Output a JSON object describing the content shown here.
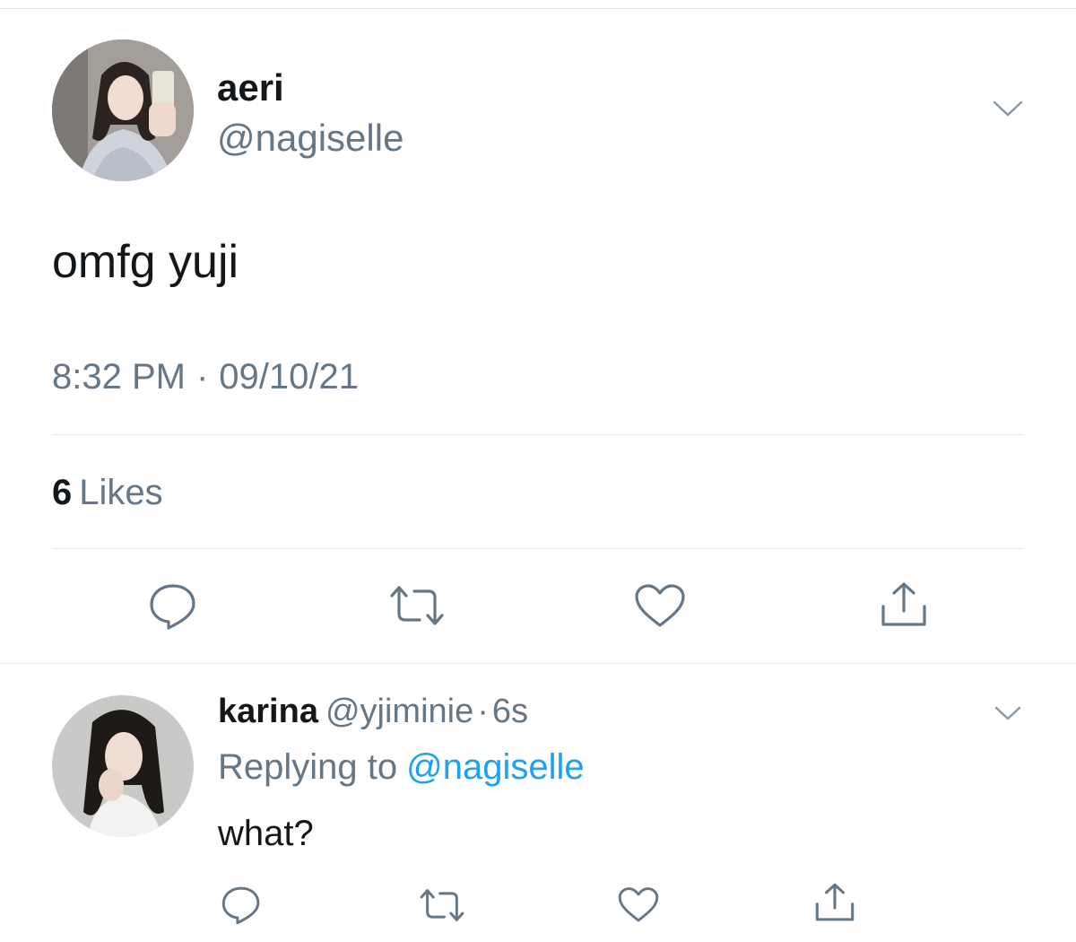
{
  "colors": {
    "text": "#14171a",
    "muted": "#657786",
    "link": "#1da1f2",
    "divider": "#e1e4e8",
    "icon": "#657786"
  },
  "main_tweet": {
    "display_name": "aeri",
    "handle": "@nagiselle",
    "text": "omfg yuji",
    "time": "8:32 PM",
    "date": "09/10/21",
    "separator": "·",
    "likes_count": "6",
    "likes_label": "Likes",
    "actions": [
      "comment-icon",
      "retweet-icon",
      "heart-icon",
      "share-icon"
    ],
    "menu_icon": "chevron-down-icon"
  },
  "reply_tweet": {
    "display_name": "karina",
    "handle": "@yjiminie",
    "separator": "·",
    "time": "6s",
    "replying_prefix": "Replying to",
    "replying_handle": "@nagiselle",
    "text": "what?",
    "actions": [
      "comment-icon",
      "retweet-icon",
      "heart-icon",
      "share-icon"
    ],
    "menu_icon": "chevron-down-icon"
  }
}
